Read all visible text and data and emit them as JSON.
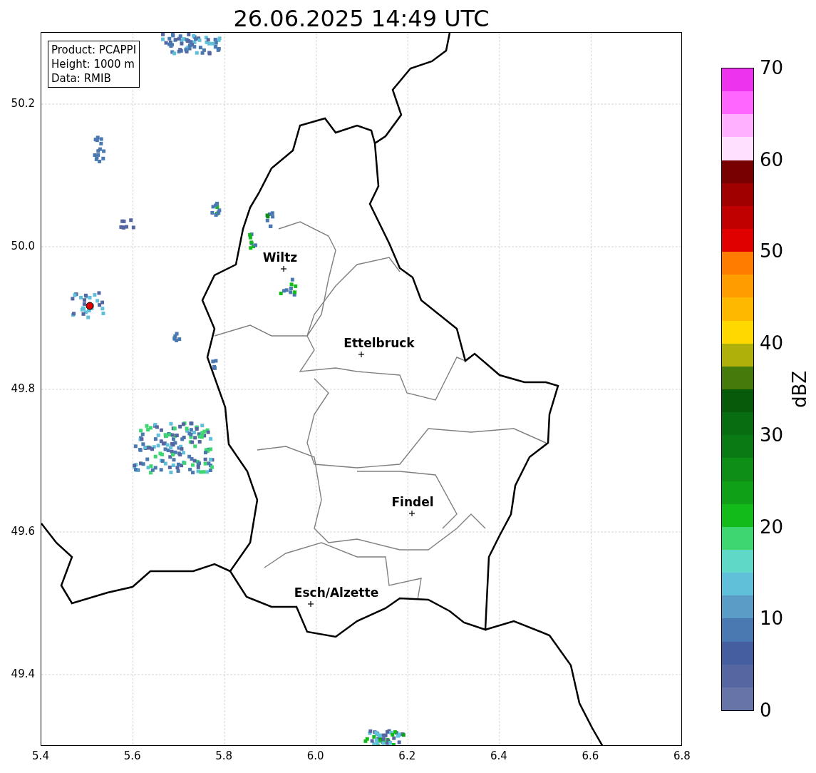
{
  "title": "26.06.2025 14:49 UTC",
  "info_box": [
    "Product: PCAPPI",
    "Height: 1000 m",
    "Data: RMIB"
  ],
  "cities": [
    {
      "name": "Wiltz"
    },
    {
      "name": "Ettelbruck"
    },
    {
      "name": "Findel"
    },
    {
      "name": "Esch/Alzette"
    }
  ],
  "y_ticks": [
    "50.2",
    "50.0",
    "49.8",
    "49.6",
    "49.4"
  ],
  "x_ticks": [
    "5.4",
    "5.6",
    "5.8",
    "6.0",
    "6.2",
    "6.4",
    "6.6",
    "6.8"
  ],
  "colorbar": {
    "label": "dBZ",
    "ticks": [
      "70",
      "60",
      "50",
      "40",
      "30",
      "20",
      "10",
      "0"
    ],
    "segments": [
      {
        "color": "#6774a8"
      },
      {
        "color": "#5566a0"
      },
      {
        "color": "#445ea0"
      },
      {
        "color": "#4a78b0"
      },
      {
        "color": "#5a9cc6"
      },
      {
        "color": "#60c0da"
      },
      {
        "color": "#60d8c8"
      },
      {
        "color": "#3dd670"
      },
      {
        "color": "#12bb1a"
      },
      {
        "color": "#10a018"
      },
      {
        "color": "#0e8e16"
      },
      {
        "color": "#0a7a14"
      },
      {
        "color": "#086c10"
      },
      {
        "color": "#065a0a"
      },
      {
        "color": "#467a0a"
      },
      {
        "color": "#b0b00a"
      },
      {
        "color": "#ffd800"
      },
      {
        "color": "#ffb800"
      },
      {
        "color": "#ff9c00"
      },
      {
        "color": "#ff7c00"
      },
      {
        "color": "#e00000"
      },
      {
        "color": "#c00000"
      },
      {
        "color": "#a00000"
      },
      {
        "color": "#780000"
      },
      {
        "color": "#ffe0ff"
      },
      {
        "color": "#ffb0ff"
      },
      {
        "color": "#ff66ff"
      },
      {
        "color": "#ee33ee"
      }
    ]
  }
}
